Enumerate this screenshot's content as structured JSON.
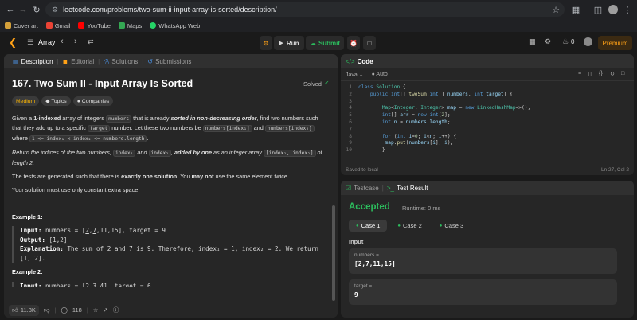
{
  "browser": {
    "url": "leetcode.com/problems/two-sum-ii-input-array-is-sorted/description/",
    "bookmarks": [
      {
        "label": "Cover art",
        "color": "#d4a03a"
      },
      {
        "label": "Gmail",
        "color": "#ea4335"
      },
      {
        "label": "YouTube",
        "color": "#ff0000"
      },
      {
        "label": "Maps",
        "color": "#34a853"
      },
      {
        "label": "WhatsApp Web",
        "color": "#25d366"
      }
    ]
  },
  "topbar": {
    "problem_list": "Array",
    "run_label": "Run",
    "submit_label": "Submit",
    "streak_count": "0",
    "premium_label": "Premium"
  },
  "left": {
    "tabs": [
      "Description",
      "Editorial",
      "Solutions",
      "Submissions"
    ],
    "title": "167. Two Sum II - Input Array Is Sorted",
    "status": "Solved",
    "tags": [
      "Medium",
      "Topics",
      "Companies"
    ],
    "footer": {
      "likes": "11.3K",
      "comments": "118"
    }
  },
  "code": {
    "header": "Code",
    "language": "Java",
    "autocomplete": "Auto",
    "saved": "Saved to local",
    "cursor": "Ln 27, Col 2"
  },
  "test": {
    "tabs": [
      "Testcase",
      "Test Result"
    ],
    "verdict": "Accepted",
    "runtime": "Runtime: 0 ms",
    "cases": [
      "Case 1",
      "Case 2",
      "Case 3"
    ],
    "input_label": "Input",
    "inputs": [
      {
        "name": "numbers =",
        "value": "[2,7,11,15]"
      },
      {
        "name": "target =",
        "value": "9"
      }
    ]
  }
}
